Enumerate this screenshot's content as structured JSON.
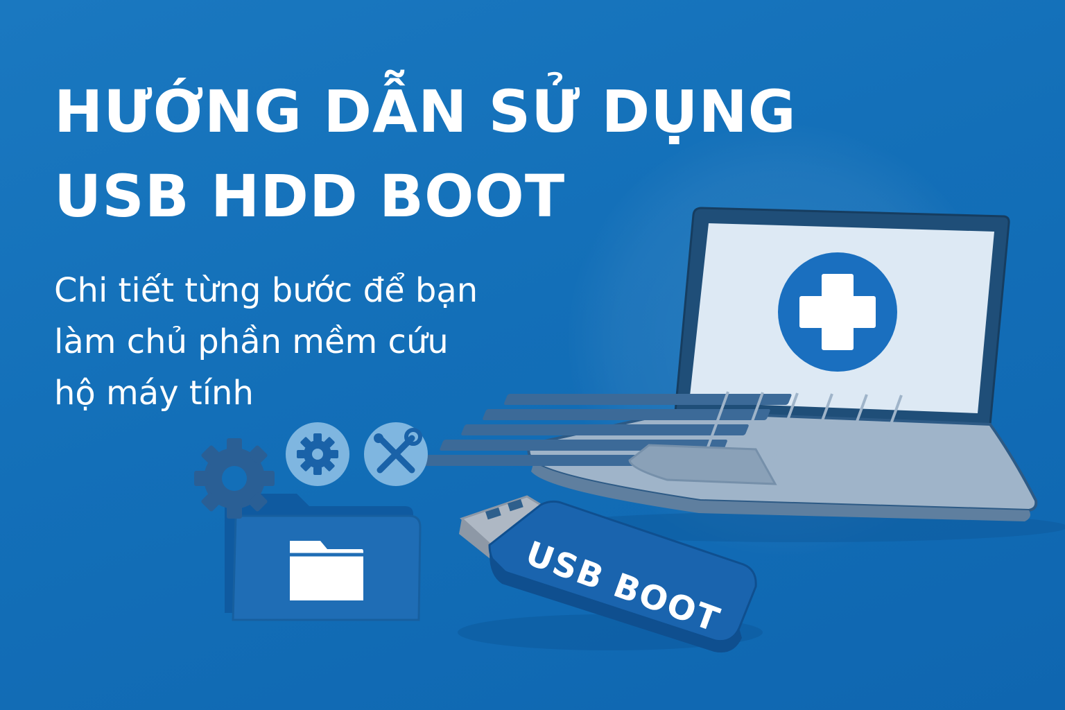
{
  "headline": {
    "line1": "HƯỚNG DẪN SỬ DỤNG",
    "line2": "USB HDD BOOT"
  },
  "subheadline": {
    "line1": "Chi tiết từng bước để bạn",
    "line2": "làm chủ phần mềm cứu",
    "line3": "hộ máy tính"
  },
  "usb_drive": {
    "label": "USB BOOT"
  },
  "icons": [
    "gear-icon",
    "settings-gear-icon",
    "tools-icon",
    "folder-icon",
    "plus-icon",
    "laptop-icon",
    "usb-drive-icon"
  ],
  "colors": {
    "background": "#136fb8",
    "accent": "#1a6fbf",
    "screen": "#dce8f3",
    "text": "#ffffff"
  }
}
